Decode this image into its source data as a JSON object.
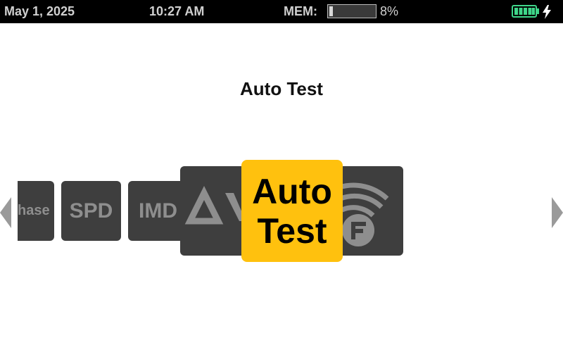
{
  "status": {
    "date": "May 1, 2025",
    "time": "10:27 AM",
    "mem_label": "MEM:",
    "mem_percent_text": "8%",
    "mem_fraction": 0.08,
    "battery_color": "#3fd68a"
  },
  "title": "Auto Test",
  "carousel": {
    "items": [
      {
        "label": "hase"
      },
      {
        "label": "SPD"
      },
      {
        "label": "IMD"
      },
      {
        "label": "AV",
        "icon": "av-icon"
      },
      {
        "label_line1": "Auto",
        "label_line2": "Test",
        "selected": true
      },
      {
        "icon": "wifi-f-icon"
      }
    ],
    "accent": "#ffc10e",
    "tile_color": "#3e3e3e",
    "tile_text_color": "#8e8e8e"
  },
  "icons": {
    "left": "chevron-left-icon",
    "right": "chevron-right-icon",
    "battery": "battery-icon",
    "charge": "charging-bolt-icon"
  }
}
